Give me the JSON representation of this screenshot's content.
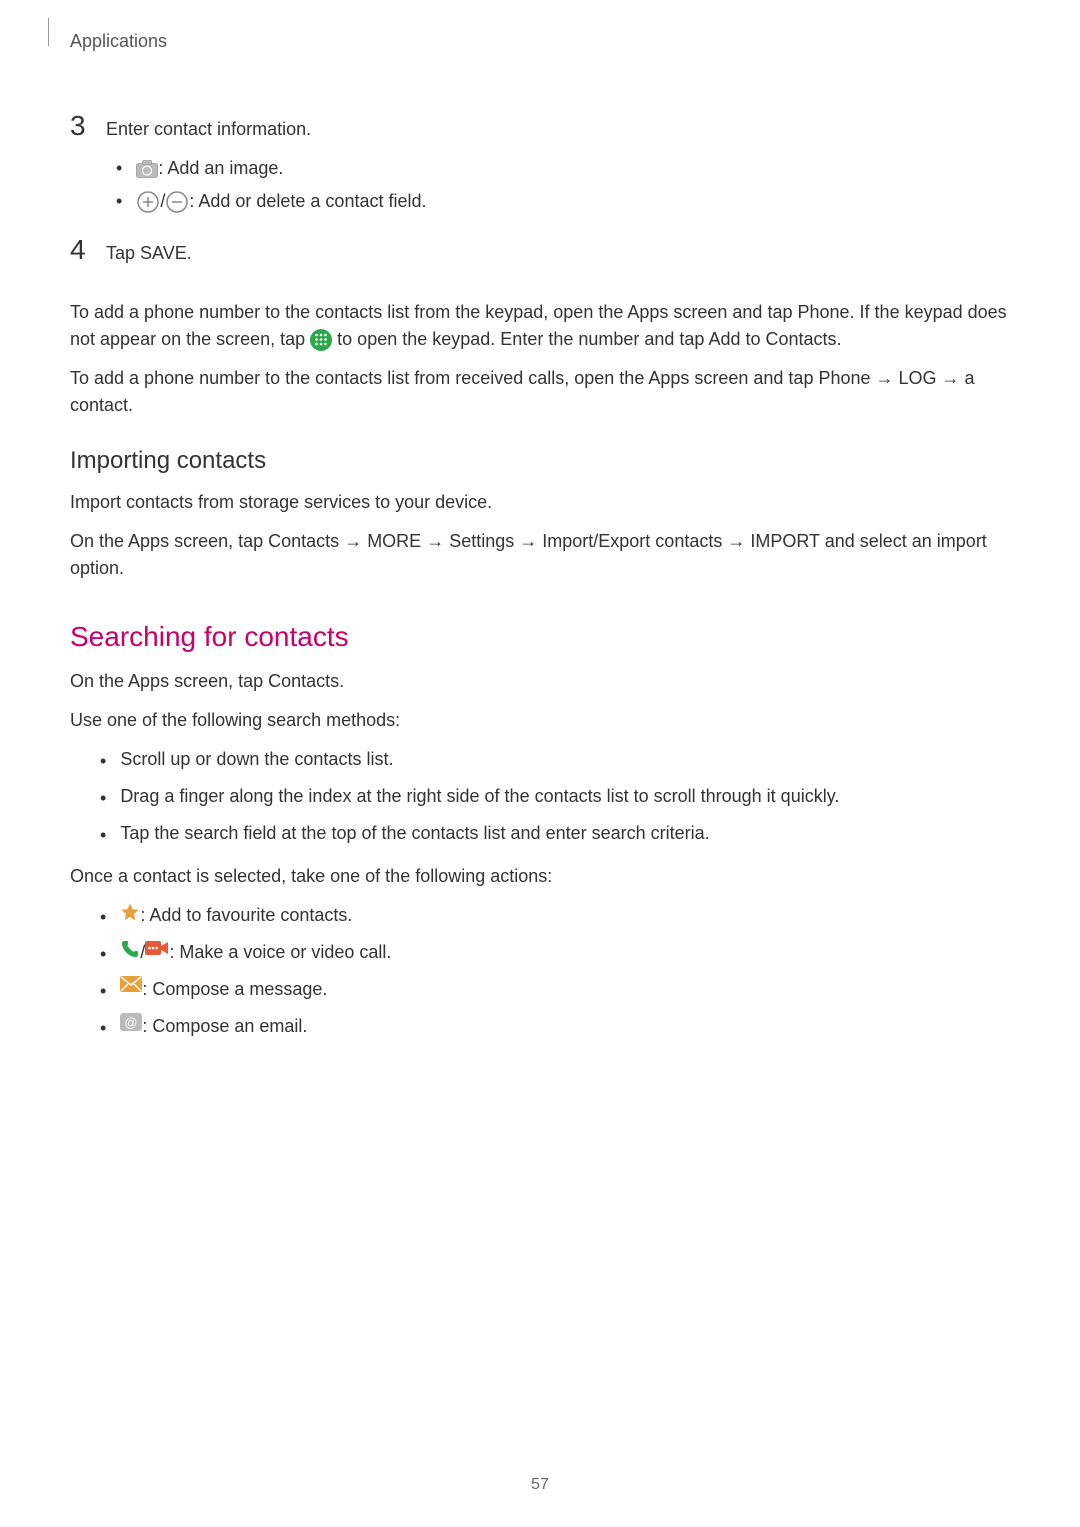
{
  "header": {
    "section": "Applications"
  },
  "step3": {
    "number": "3",
    "text": "Enter contact information.",
    "sub1_text": " : Add an image.",
    "sub2_text_a": " / ",
    "sub2_text_b": " : Add or delete a contact field."
  },
  "step4": {
    "number": "4",
    "text_a": "Tap ",
    "text_b": "SAVE",
    "text_c": "."
  },
  "para_keypad": {
    "a": "To add a phone number to the contacts list from the keypad, open the Apps screen and tap ",
    "b": "Phone",
    "c": ". If the keypad does not appear on the screen, tap ",
    "d": " to open the keypad. Enter the number and tap ",
    "e": "Add to Contacts",
    "f": "."
  },
  "para_received": {
    "a": "To add a phone number to the contacts list from received calls, open the Apps screen and tap ",
    "b": "Phone",
    "c": " → ",
    "d": "LOG",
    "e": " → a contact."
  },
  "importing": {
    "heading": "Importing contacts",
    "p1": "Import contacts from storage services to your device.",
    "p2_a": "On the Apps screen, tap ",
    "p2_b": "Contacts",
    "p2_c": " → ",
    "p2_d": "MORE",
    "p2_e": " → ",
    "p2_f": "Settings",
    "p2_g": " → ",
    "p2_h": "Import/Export contacts",
    "p2_i": " → ",
    "p2_j": "IMPORT",
    "p2_k": " and select an import option."
  },
  "searching": {
    "heading": "Searching for contacts",
    "p1_a": "On the Apps screen, tap ",
    "p1_b": "Contacts",
    "p1_c": ".",
    "p2": "Use one of the following search methods:",
    "bullets": {
      "b1": "Scroll up or down the contacts list.",
      "b2": "Drag a finger along the index at the right side of the contacts list to scroll through it quickly.",
      "b3": "Tap the search field at the top of the contacts list and enter search criteria."
    },
    "p3": "Once a contact is selected, take one of the following actions:",
    "actions": {
      "a1": " : Add to favourite contacts.",
      "a2_a": " / ",
      "a2_b": " : Make a voice or video call.",
      "a3": " : Compose a message.",
      "a4": " : Compose an email."
    }
  },
  "page_number": "57"
}
